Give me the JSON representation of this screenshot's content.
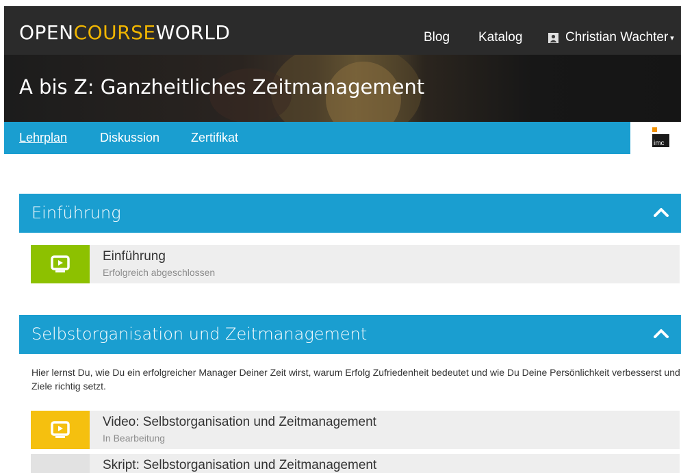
{
  "brand": {
    "part1": "OPEN",
    "part2": "COURSE",
    "part3": "WORLD"
  },
  "nav": {
    "blog": "Blog",
    "katalog": "Katalog",
    "user_name": "Christian Wachter"
  },
  "course": {
    "title": "A bis Z: Ganzheitliches Zeitmanagement"
  },
  "tabs": [
    {
      "label": "Lehrplan",
      "active": true
    },
    {
      "label": "Diskussion",
      "active": false
    },
    {
      "label": "Zertifikat",
      "active": false
    }
  ],
  "partner_logo": {
    "text": "imc"
  },
  "sections": [
    {
      "title": "Einführung",
      "lessons": [
        {
          "title": "Einführung",
          "status": "Erfolgreich abgeschlossen",
          "icon": "video-icon",
          "color": "#8dc100"
        }
      ]
    },
    {
      "title": "Selbstorganisation und Zeitmanagement",
      "description": "Hier lernst Du, wie Du ein erfolgreicher Manager Deiner Zeit wirst, warum Erfolg Zufriedenheit bedeutet und wie Du Deine Persönlichkeit verbesserst und Ziele richtig setzt.",
      "lessons": [
        {
          "title": "Video: Selbstorganisation und Zeitmanagement",
          "status": "In Bearbeitung",
          "icon": "video-icon",
          "color": "#f5c00f"
        },
        {
          "title": "Skript: Selbstorganisation und Zeitmanagement",
          "status": "",
          "icon": "document-icon",
          "color": "#d9d9d9"
        }
      ]
    }
  ],
  "colors": {
    "topbar": "#2b2b2b",
    "accent_blue": "#1a9ed0",
    "brand_yellow": "#f0b500",
    "done_green": "#8dc100",
    "progress_yellow": "#f5c00f"
  }
}
